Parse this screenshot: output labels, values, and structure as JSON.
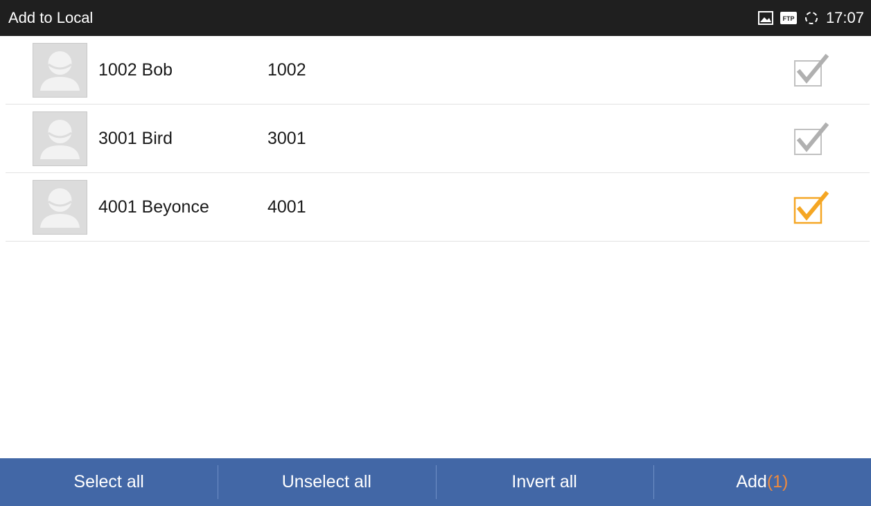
{
  "status_bar": {
    "title": "Add to Local",
    "time": "17:07",
    "icons": [
      "picture-icon",
      "ftp-icon",
      "sync-icon"
    ],
    "ftp_label": "FTP"
  },
  "contacts": [
    {
      "name": "1002 Bob",
      "number": "1002",
      "checked": false
    },
    {
      "name": "3001 Bird",
      "number": "3001",
      "checked": false
    },
    {
      "name": "4001 Beyonce",
      "number": "4001",
      "checked": true
    }
  ],
  "bottom_bar": {
    "select_all": "Select all",
    "unselect_all": "Unselect all",
    "invert_all": "Invert all",
    "add_label": "Add",
    "add_count": "(1)"
  },
  "colors": {
    "status_bar_bg": "#1f1f1f",
    "bottom_bar_bg": "#4267a6",
    "accent_orange": "#f5a623",
    "add_count_color": "#f08a3c",
    "unchecked_gray": "#b0b0b0"
  }
}
